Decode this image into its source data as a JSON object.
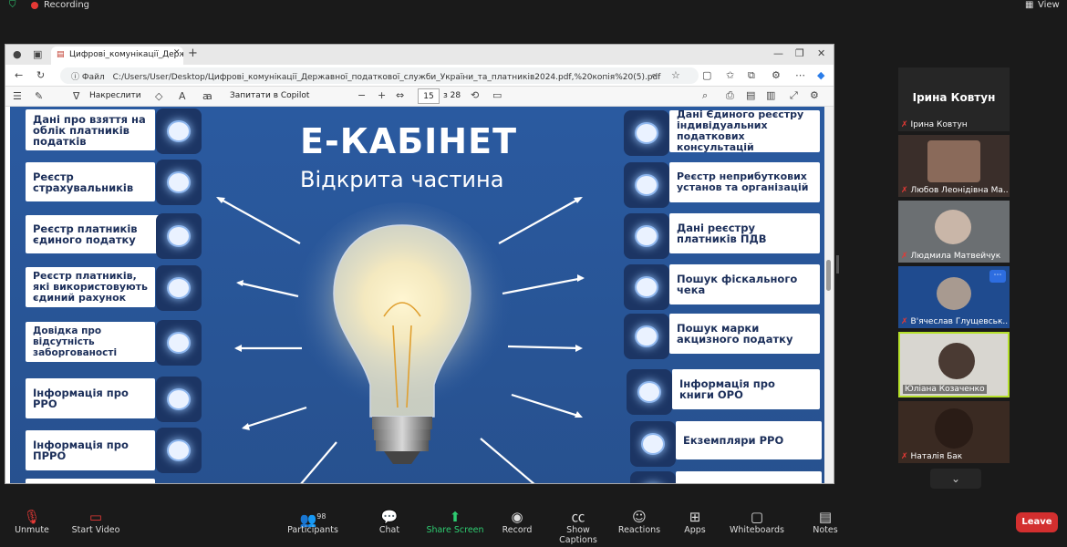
{
  "zoom": {
    "recording_label": "Recording",
    "view_label": "View",
    "participants_count": "98",
    "toolbar": [
      {
        "label": "Unmute",
        "icon": "mic-muted-icon"
      },
      {
        "label": "Start Video",
        "icon": "video-off-icon"
      },
      {
        "label": "Participants",
        "icon": "participants-icon"
      },
      {
        "label": "Chat",
        "icon": "chat-icon"
      },
      {
        "label": "Share Screen",
        "icon": "share-screen-icon"
      },
      {
        "label": "Record",
        "icon": "record-icon"
      },
      {
        "label": "Show Captions",
        "icon": "cc-icon"
      },
      {
        "label": "Reactions",
        "icon": "reactions-icon"
      },
      {
        "label": "Apps",
        "icon": "apps-icon"
      },
      {
        "label": "Whiteboards",
        "icon": "whiteboard-icon"
      },
      {
        "label": "Notes",
        "icon": "notes-icon"
      }
    ],
    "leave_label": "Leave",
    "participants": [
      {
        "name": "Ірина Ковтун",
        "big_name": "Ірина Ковтун"
      },
      {
        "name": "Любов Леонідівна Ма..."
      },
      {
        "name": "Людмила Матвейчук"
      },
      {
        "name": "В'ячеслав Глущевськ..."
      },
      {
        "name": "Юліана Козаченко"
      },
      {
        "name": "Наталія Бак"
      }
    ]
  },
  "browser": {
    "tab_title": "Цифрові_комунікації_Державної",
    "address_prefix": "Файл",
    "address": "C:/Users/User/Desktop/Цифрові_комунікації_Державної_податкової_служби_України_та_платників2024.pdf,%20копія%20(5).pdf",
    "draw_label": "Накреслити",
    "copilot_label": "Запитати в Copilot",
    "page_current": "15",
    "page_total": "з 28"
  },
  "slide": {
    "title": "Е-КАБІНЕТ",
    "subtitle": "Відкрита частина",
    "left_items": [
      "Дані про взяття на облік платників податків",
      "Реєстр страхувальників",
      "Реєстр платників єдиного податку",
      "Реєстр платників, які використовують єдиний рахунок",
      "Довідка про відсутність заборгованості",
      "Інформація про РРО",
      "Інформація про ПРРО"
    ],
    "right_items": [
      "Дані Єдиного реєстру індивідуальних податкових консультацій",
      "Реєстр неприбуткових установ та організацій",
      "Дані реєстру платників ПДВ",
      "Пошук фіскального чека",
      "Пошук марки акцизного податку",
      "Інформація про книги ОРО",
      "Екземпляри РРО"
    ]
  }
}
